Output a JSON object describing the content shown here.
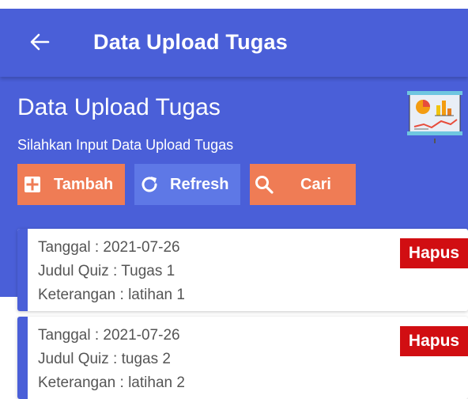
{
  "appbar": {
    "title": "Data Upload Tugas"
  },
  "header": {
    "title": "Data Upload Tugas",
    "subtitle": "Silahkan Input Data Upload Tugas"
  },
  "toolbar": {
    "add_label": "Tambah",
    "refresh_label": "Refresh",
    "search_label": "Cari"
  },
  "records": [
    {
      "tanggal": "Tanggal : 2021-07-26",
      "judul": "Judul Quiz : Tugas 1",
      "keterangan": "Keterangan : latihan 1",
      "delete_label": "Hapus"
    },
    {
      "tanggal": "Tanggal : 2021-07-26",
      "judul": "Judul Quiz : tugas 2",
      "keterangan": "Keterangan : latihan 2",
      "delete_label": "Hapus"
    }
  ],
  "icons": {
    "back": "arrow-left-icon",
    "add": "plus-box-icon",
    "refresh": "refresh-icon",
    "search": "search-icon",
    "illustration": "chart-presentation-icon"
  },
  "colors": {
    "primary": "#4a5fd8",
    "accent_orange": "#ef7c55",
    "accent_blue": "#5e78e6",
    "danger": "#d10e12"
  }
}
